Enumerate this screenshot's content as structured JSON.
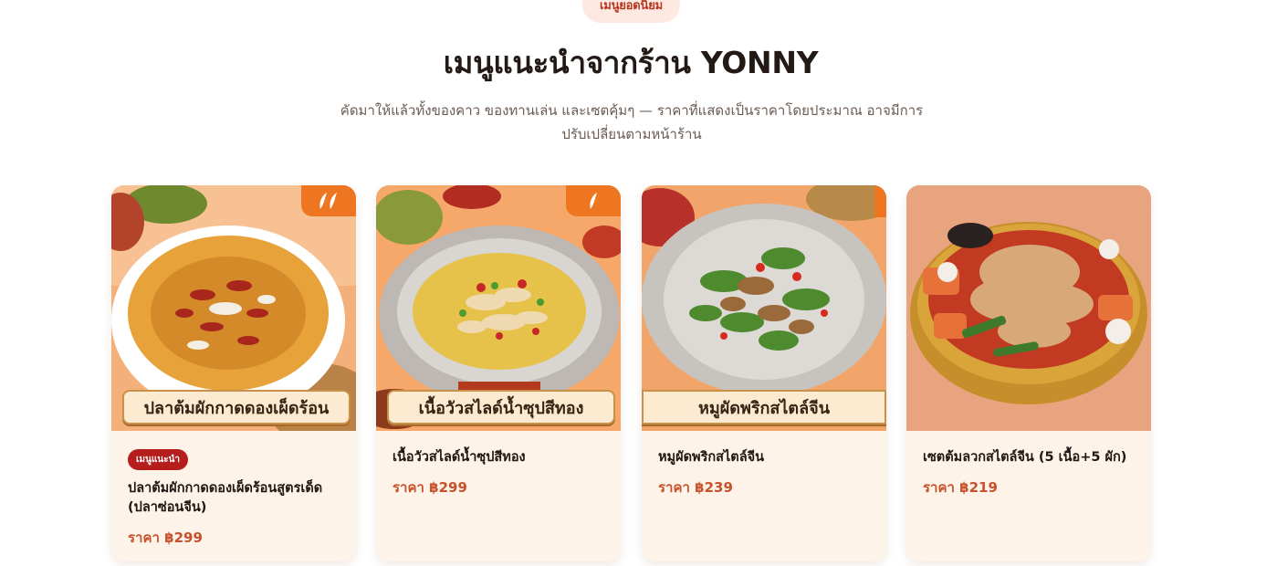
{
  "section": {
    "tag": "เมนูยอดนิยม",
    "title": "เมนูแนะนำจากร้าน YONNY",
    "subtitle": "คัดมาให้แล้วทั้งของคาว ของทานเล่น และเซตคุ้มๆ — ราคาที่แสดงเป็นราคาโดยประมาณ อาจมีการปรับเปลี่ยนตามหน้าร้าน"
  },
  "cards": [
    {
      "badge": "เมนูแนะนำ",
      "name": "ปลาต้มผักกาดดองเผ็ดร้อนสูตรเด็ด (ปลาซ่อนจีน)",
      "price": "ราคา ฿299",
      "banner": "ปลาต้มผักกาดดองเผ็ดร้อน",
      "spicy_icon": "chili-icon",
      "colors": {
        "bg": "#f4b07a",
        "plate": "#ffffff",
        "food": "#e7a33a"
      }
    },
    {
      "name": "เนื้อวัวสไลด์น้ำซุปสีทอง",
      "price": "ราคา ฿299",
      "banner": "เนื้อวัวสไลด์น้ำซุปสีทอง",
      "spicy_icon": "chili-icon",
      "colors": {
        "bg": "#f6a76a",
        "plate": "#c9c5c2",
        "food": "#e6c24a"
      }
    },
    {
      "name": "หมูผัดพริกสไตล์จีน",
      "price": "ราคา ฿239",
      "banner": "หมูผัดพริกสไตล์จีน",
      "colors": {
        "bg": "#f2a56b",
        "plate": "#cfcbc6",
        "food": "#4e8a2e"
      }
    },
    {
      "name": "เซตต้มลวกสไตล์จีน (5 เนื้อ+5 ผัก)",
      "price": "ราคา ฿219",
      "colors": {
        "bg": "#e8a47e",
        "plate": "#d9a43a",
        "food": "#d4603a"
      }
    }
  ]
}
